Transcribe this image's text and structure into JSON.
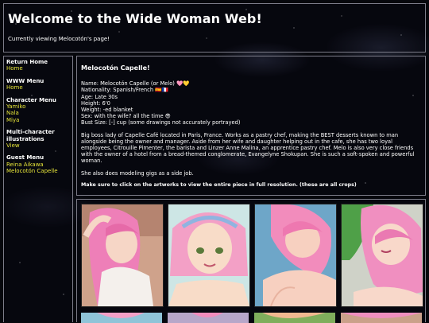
{
  "header": {
    "title": "Welcome to the Wide Woman Web!",
    "subtitle": "Currently viewing Melocotón's page!"
  },
  "sidebar": {
    "sections": [
      {
        "heading": "Return Home",
        "links": [
          "Home"
        ]
      },
      {
        "heading": "WWW Menu",
        "links": [
          "Home"
        ]
      },
      {
        "heading": "Character Menu",
        "links": [
          "Yamiko",
          "Nala",
          "Miya"
        ]
      },
      {
        "heading": "Multi-character illustrations",
        "links": [
          "View"
        ]
      },
      {
        "heading": "Guest Menu",
        "links": [
          "Reina Aikawa",
          "Melocotón Capelle"
        ]
      }
    ]
  },
  "profile": {
    "name": "Melocotón Capelle!",
    "stats": [
      "Name: Melocotón Capelle (or Melo) 🩷💛",
      "Nationality: Spanish/French 🇪🇸🇫🇷",
      "Age: Late 30s",
      "Height: 6'0",
      "Weight: -ed blanket",
      "Sex: with the wife? all the time 😎",
      "Bust Size: [-] cup (some drawings not accurately portrayed)"
    ],
    "bio": "Big boss lady of Capelle Café located in Paris, France. Works as a pastry chef, making the BEST desserts known to man alongside being the owner and manager. Aside from her wife and daughter helping out in the cafe, she has two loyal employees, Citrouille Pimenter, the barista and Linzer Anne Malina, an apprentice pastry chef. Melo is also very close friends with the owner of a hotel from a bread-themed conglomerate, Evangelyne Shokupan. She is such a soft-spoken and powerful woman.",
    "extra": "She also does modeling gigs as a side job.",
    "note": "Make sure to click on the artworks to view the entire piece in full resolution. (these are all crops)"
  },
  "gallery": {
    "thumbs": [
      {
        "name": "artwork-1",
        "bg": "#d8b39a",
        "hair": "#ee7fb8"
      },
      {
        "name": "artwork-2",
        "bg": "#cfe6e4",
        "hair": "#f3a0c6"
      },
      {
        "name": "artwork-3",
        "bg": "#6fa7c9",
        "hair": "#f28cbc"
      },
      {
        "name": "artwork-4",
        "bg": "#5aa356",
        "hair": "#f08fc0"
      }
    ]
  },
  "colors": {
    "link": "#e8e63a",
    "border": "#7d7d8a",
    "background": "#06070c"
  }
}
